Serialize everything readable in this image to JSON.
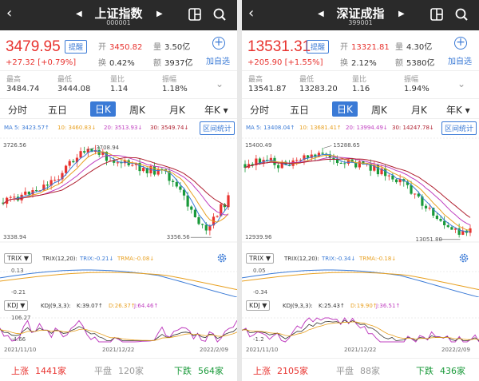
{
  "panels": [
    {
      "name": "上证指数",
      "code": "000001",
      "price": "3479.95",
      "remind": "提醒",
      "change": "+27.32",
      "change_pct": "[+0.79%]",
      "open_label": "开",
      "open": "3450.82",
      "vol_label": "量",
      "vol": "3.50亿",
      "turn_label": "换",
      "turn": "0.42%",
      "amt_label": "额",
      "amt": "3937亿",
      "add_label": "加自选",
      "high_label": "最高",
      "high": "3484.74",
      "low_label": "最低",
      "low": "3444.08",
      "ratio_label": "量比",
      "ratio": "1.14",
      "amp_label": "振幅",
      "amp": "1.18%",
      "tabs": [
        "分时",
        "五日",
        "日K",
        "周K",
        "月K",
        "年K"
      ],
      "active_tab": "日K",
      "ma5": "MA 5: 3423.57↑",
      "ma10": "10: 3460.83↓",
      "ma20": "20: 3513.93↓",
      "ma30": "30: 3549.74↓",
      "range_btn": "区间统计",
      "k_top": "3726.56",
      "k_bottom": "3338.94",
      "k_peak": "3708.94",
      "k_trough": "3356.56",
      "trix_btn": "TRIX",
      "trix_params": "TRIX(12,20):",
      "trix": "TRIX:-0.21↓",
      "trma": "TRMA:-0.08↓",
      "trix_top": "0.13",
      "trix_bottom": "-0.21",
      "kdj_btn": "KDJ",
      "kdj_params": "KDJ(9,3,3):",
      "kdj_k": "K:39.07↑",
      "kdj_d": "D:26.37↑",
      "kdj_j": "J:64.46↑",
      "kdj_top": "106.27",
      "kdj_bottom": "-4.66",
      "dates": [
        "2021/11/10",
        "2021/12/22",
        "2022/2/09"
      ],
      "up_label": "上涨",
      "up": "1441家",
      "flat_label": "平盘",
      "flat": "120家",
      "down_label": "下跌",
      "down": "564家"
    },
    {
      "name": "深证成指",
      "code": "399001",
      "price": "13531.31",
      "remind": "提醒",
      "change": "+205.90",
      "change_pct": "[+1.55%]",
      "open_label": "开",
      "open": "13321.81",
      "vol_label": "量",
      "vol": "4.30亿",
      "turn_label": "换",
      "turn": "2.12%",
      "amt_label": "额",
      "amt": "5380亿",
      "add_label": "加自选",
      "high_label": "最高",
      "high": "13541.87",
      "low_label": "最低",
      "low": "13283.20",
      "ratio_label": "量比",
      "ratio": "1.16",
      "amp_label": "振幅",
      "amp": "1.94%",
      "tabs": [
        "分时",
        "五日",
        "日K",
        "周K",
        "月K",
        "年K"
      ],
      "active_tab": "日K",
      "ma5": "MA 5: 13408.04↑",
      "ma10": "10: 13681.41↑",
      "ma20": "20: 13994.49↓",
      "ma30": "30: 14247.78↓",
      "range_btn": "区间统计",
      "k_top": "15400.49",
      "k_bottom": "12939.96",
      "k_peak": "15288.65",
      "k_trough": "13051.80",
      "trix_btn": "TRIX",
      "trix_params": "TRIX(12,20):",
      "trix": "TRIX:-0.34↓",
      "trma": "TRMA:-0.18↓",
      "trix_top": "0.05",
      "trix_bottom": "-0.34",
      "kdj_btn": "KDJ",
      "kdj_params": "KDJ(9,3,3):",
      "kdj_k": "K:25.43↑",
      "kdj_d": "D:19.90↑",
      "kdj_j": "J:36.51↑",
      "kdj_top": "",
      "kdj_bottom": "-1.2",
      "dates": [
        "2021/11/10",
        "2021/12/22",
        "2022/2/09"
      ],
      "up_label": "上涨",
      "up": "2105家",
      "flat_label": "平盘",
      "flat": "88家",
      "down_label": "下跌",
      "down": "436家"
    }
  ],
  "colors": {
    "up": "#e8322e",
    "down": "#1a9a3a",
    "accent": "#3a7ad6",
    "header": "#2a2a2a",
    "ma5": "#3a7ad6",
    "ma10": "#e8a020",
    "ma20": "#c040c0",
    "ma30": "#b02030"
  },
  "chart_data": [
    {
      "type": "candlestick",
      "title": "上证指数 日K",
      "xlabel": "",
      "ylabel": "",
      "x_ticks": [
        "2021/11/10",
        "2021/12/22",
        "2022/2/09"
      ],
      "ylim": [
        3338.94,
        3726.56
      ],
      "annotations": [
        {
          "label": "3708.94",
          "kind": "high"
        },
        {
          "label": "3356.56",
          "kind": "low"
        }
      ],
      "last_close": 3479.95
    },
    {
      "type": "candlestick",
      "title": "深证成指 日K",
      "xlabel": "",
      "ylabel": "",
      "x_ticks": [
        "2021/11/10",
        "2021/12/22",
        "2022/2/09"
      ],
      "ylim": [
        12939.96,
        15400.49
      ],
      "annotations": [
        {
          "label": "15288.65",
          "kind": "high"
        },
        {
          "label": "13051.80",
          "kind": "low"
        }
      ],
      "last_close": 13531.31
    }
  ]
}
